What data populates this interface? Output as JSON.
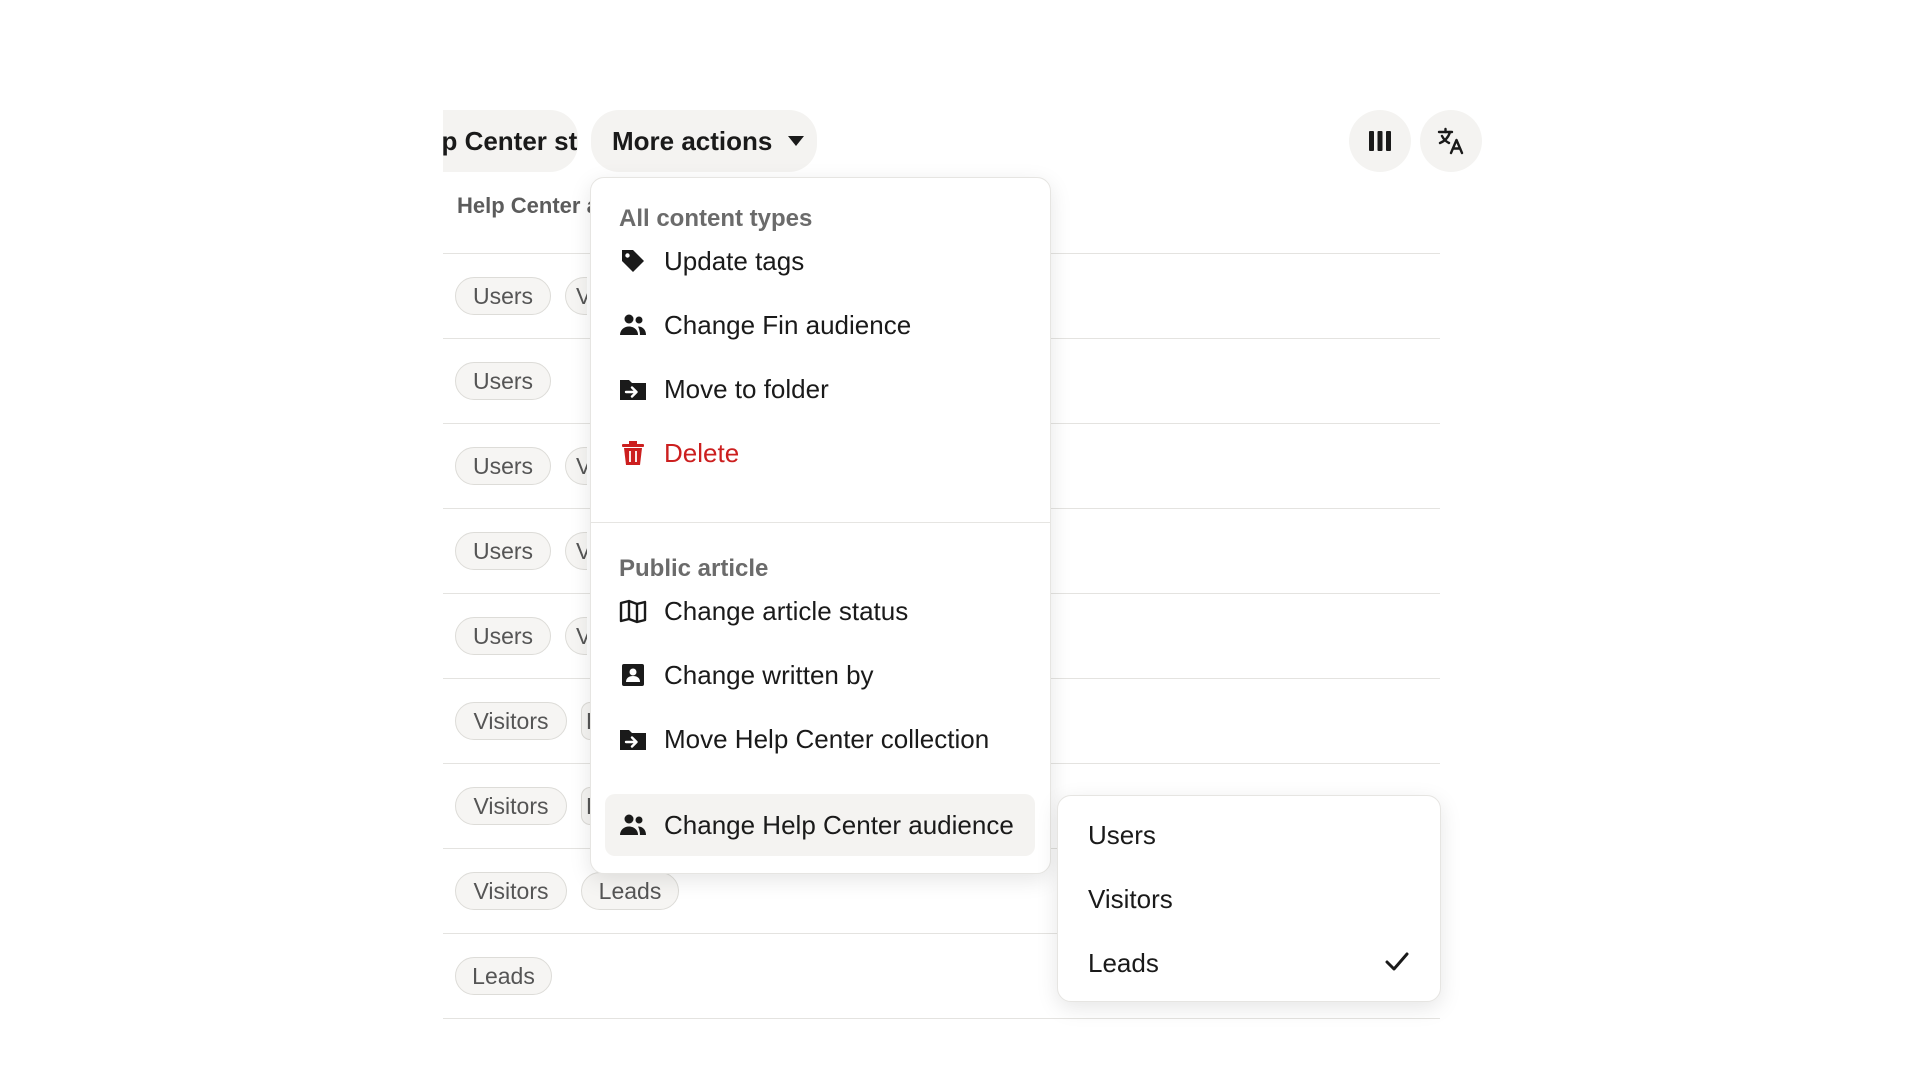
{
  "toolbar": {
    "prev_filter_label": "Help Center state",
    "more_actions_label": "More actions"
  },
  "table": {
    "column_header": "Help Center audience",
    "rows": [
      {
        "chips": [
          "Users",
          "Visitors"
        ]
      },
      {
        "chips": [
          "Users"
        ]
      },
      {
        "chips": [
          "Users",
          "Visitors"
        ]
      },
      {
        "chips": [
          "Users",
          "Visitors"
        ]
      },
      {
        "chips": [
          "Users",
          "Visitors"
        ]
      },
      {
        "chips": [
          "Visitors",
          "Leads"
        ]
      },
      {
        "chips": [
          "Visitors",
          "Leads"
        ]
      },
      {
        "chips": [
          "Visitors",
          "Leads"
        ]
      },
      {
        "chips": [
          "Leads"
        ]
      }
    ]
  },
  "menu": {
    "section_all": {
      "heading": "All content types",
      "items": [
        {
          "label": "Update tags",
          "icon": "tag-icon"
        },
        {
          "label": "Change Fin audience",
          "icon": "people-icon"
        },
        {
          "label": "Move to folder",
          "icon": "folder-move-icon"
        },
        {
          "label": "Delete",
          "icon": "trash-icon"
        }
      ]
    },
    "section_public": {
      "heading": "Public article",
      "items": [
        {
          "label": "Change article status",
          "icon": "book-open-icon"
        },
        {
          "label": "Change written by",
          "icon": "person-card-icon"
        },
        {
          "label": "Move Help Center collection",
          "icon": "folder-move-icon"
        },
        {
          "label": "Change Help Center audience",
          "icon": "people-icon"
        }
      ]
    }
  },
  "submenu": {
    "options": [
      {
        "label": "Users",
        "selected": false
      },
      {
        "label": "Visitors",
        "selected": false
      },
      {
        "label": "Leads",
        "selected": true
      }
    ]
  },
  "colors": {
    "danger": "#cc1f1f",
    "pill_bg": "#f4f3f1",
    "chip_border": "#dddcd8"
  }
}
